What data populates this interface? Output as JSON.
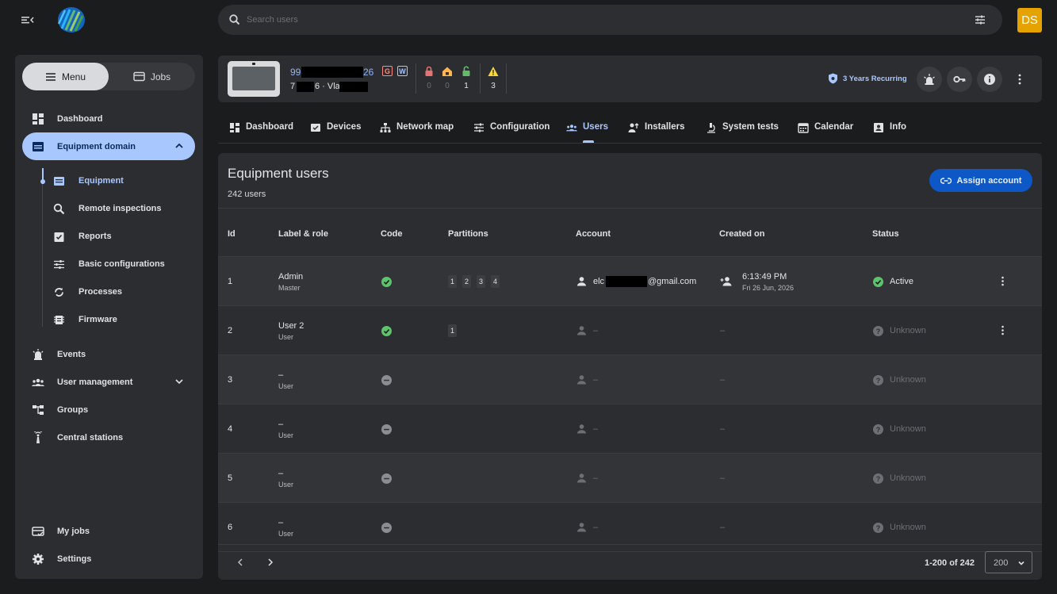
{
  "search": {
    "placeholder": "Search users"
  },
  "user": {
    "initials": "DS"
  },
  "sidebar": {
    "segments": {
      "menu": "Menu",
      "jobs": "Jobs"
    },
    "items": {
      "dashboard": "Dashboard",
      "equipment_domain": "Equipment domain",
      "equipment": "Equipment",
      "remote_inspections": "Remote inspections",
      "reports": "Reports",
      "basic_configurations": "Basic configurations",
      "processes": "Processes",
      "firmware": "Firmware",
      "events": "Events",
      "user_management": "User management",
      "groups": "Groups",
      "central_stations": "Central stations",
      "my_jobs": "My jobs",
      "settings": "Settings"
    }
  },
  "device": {
    "id_prefix": "99",
    "id_suffix": "26",
    "loc_prefix": "7",
    "loc_mid": "6 · Vla",
    "badges": {
      "g": "G",
      "w": "W"
    },
    "stats": {
      "armed": "0",
      "home": "0",
      "disarmed": "1",
      "alerts": "3"
    },
    "plan": "3 Years Recurring"
  },
  "tabs": {
    "dashboard": "Dashboard",
    "devices": "Devices",
    "network_map": "Network map",
    "configuration": "Configuration",
    "users": "Users",
    "installers": "Installers",
    "system_tests": "System tests",
    "calendar": "Calendar",
    "info": "Info"
  },
  "panel": {
    "title": "Equipment users",
    "count": "242 users",
    "assign": "Assign account",
    "columns": {
      "id": "Id",
      "label": "Label & role",
      "code": "Code",
      "partitions": "Partitions",
      "account": "Account",
      "created": "Created on",
      "status": "Status"
    }
  },
  "rows": [
    {
      "id": "1",
      "label": "Admin",
      "role": "Master",
      "partitions": [
        "1",
        "2",
        "3",
        "4"
      ],
      "account_prefix": "elc",
      "account_suffix": "@gmail.com",
      "created_time": "6:13:49 PM",
      "created_date": "Fri 26 Jun, 2026",
      "status": "Active"
    },
    {
      "id": "2",
      "label": "User 2",
      "role": "User",
      "partitions": [
        "1"
      ],
      "account": "–",
      "created": "–",
      "status": "Unknown"
    },
    {
      "id": "3",
      "label": "–",
      "role": "User",
      "account": "–",
      "created": "–",
      "status": "Unknown"
    },
    {
      "id": "4",
      "label": "–",
      "role": "User",
      "account": "–",
      "created": "–",
      "status": "Unknown"
    },
    {
      "id": "5",
      "label": "–",
      "role": "User",
      "account": "–",
      "created": "–",
      "status": "Unknown"
    },
    {
      "id": "6",
      "label": "–",
      "role": "User",
      "account": "–",
      "created": "–",
      "status": "Unknown"
    }
  ],
  "pagination": {
    "range": "1-200 of 242",
    "page_size": "200"
  },
  "colors": {
    "accent": "#a9c7ff",
    "primary_button": "#0d57c7",
    "success": "#4caf50",
    "avatar": "#e6a300"
  }
}
